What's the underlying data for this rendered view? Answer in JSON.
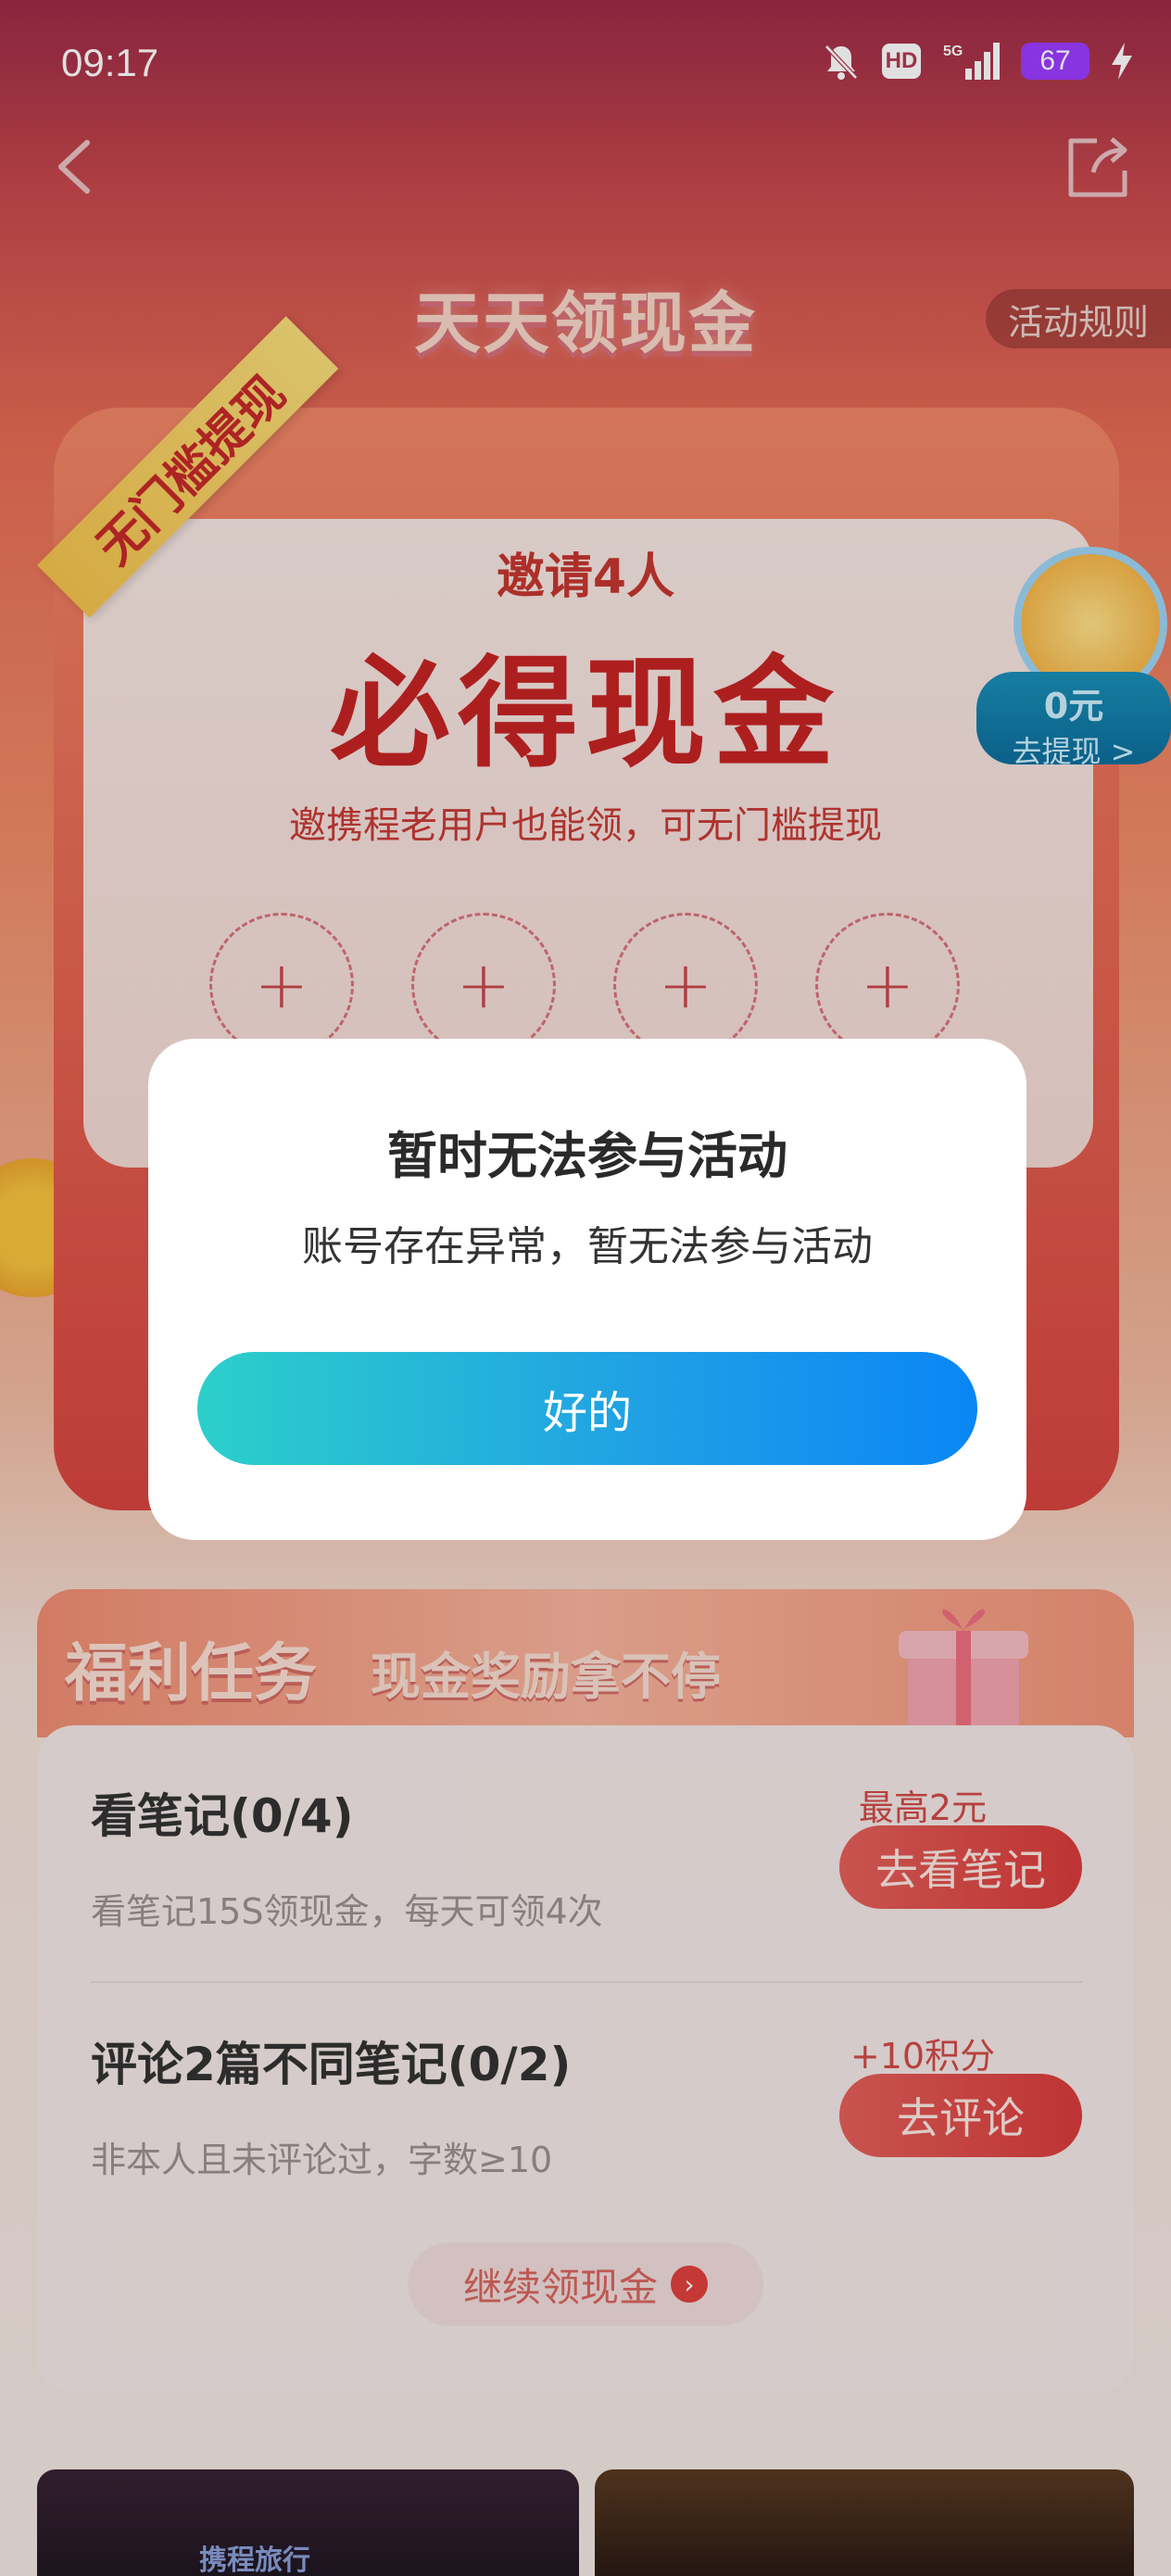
{
  "status_bar": {
    "time": "09:17",
    "network": "5G",
    "hd": "HD",
    "battery": "67"
  },
  "header": {
    "title": "天天领现金",
    "rules_label": "活动规则"
  },
  "invite": {
    "badge": "无门槛提现",
    "subtitle": "邀请4人",
    "headline": "必得现金",
    "description": "邀携程老用户也能领，可无门槛提现",
    "slots": [
      "+",
      "+",
      "+",
      "+"
    ]
  },
  "withdraw": {
    "amount": "0元",
    "label": "去提现 >"
  },
  "welfare": {
    "title": "福利任务",
    "slogan": "现金奖励拿不停",
    "tasks": [
      {
        "title": "看笔记(0/4)",
        "description": "看笔记15S领现金，每天可领4次",
        "reward": "最高2元",
        "button": "去看笔记"
      },
      {
        "title": "评论2篇不同笔记(0/2)",
        "description": "非本人且未评论过，字数≥10",
        "reward": "+10积分",
        "button": "去评论"
      }
    ],
    "continue_label": "继续领现金"
  },
  "banners": {
    "left_label": "携程旅行"
  },
  "dialog": {
    "title": "暂时无法参与活动",
    "message": "账号存在异常，暂无法参与活动",
    "confirm": "好的"
  },
  "colors": {
    "accent_gradient_start": "#2ccfca",
    "accent_gradient_end": "#0a86f5",
    "brand_red": "#d93b3b"
  }
}
